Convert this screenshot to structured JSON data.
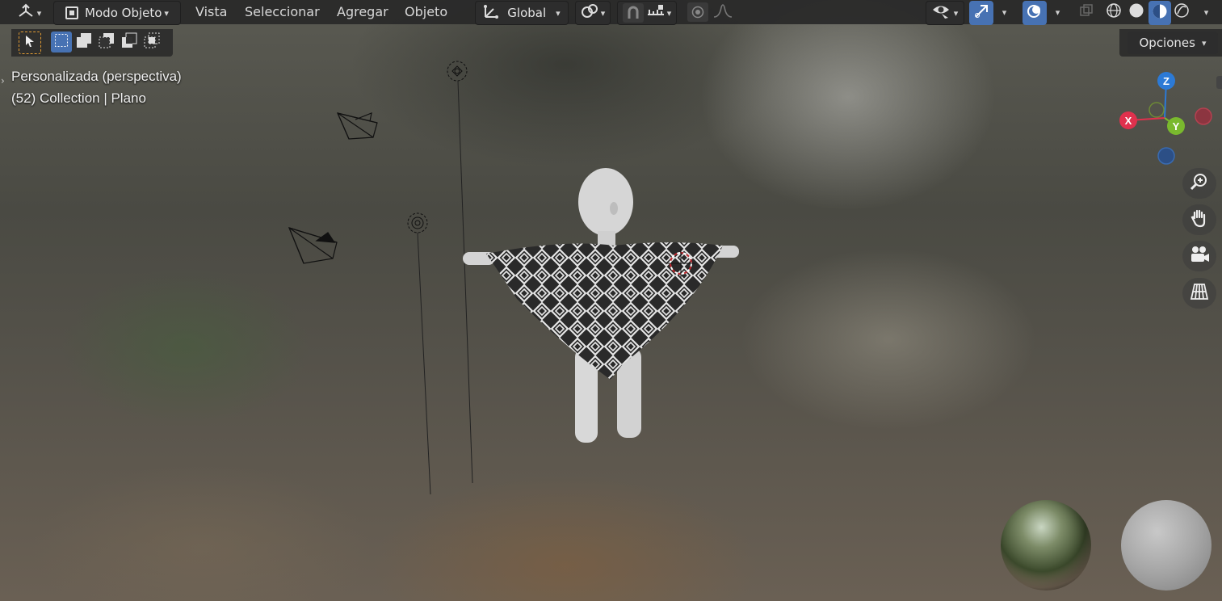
{
  "header": {
    "editor_type_icon": "viewport-gizmo-icon",
    "mode_label": "Modo Objeto",
    "menus": [
      "Vista",
      "Seleccionar",
      "Agregar",
      "Objeto"
    ],
    "transform_orientation": "Global"
  },
  "toolbar": {
    "select_modes": [
      "select-new",
      "select-extend",
      "select-subtract",
      "select-invert",
      "select-intersect"
    ]
  },
  "overlay": {
    "view_name": "Personalizada (perspectiva)",
    "collection_info": "(52) Collection | Plano"
  },
  "options_label": "Opciones",
  "gizmo": {
    "z": "Z",
    "x": "X",
    "y": "Y"
  },
  "colors": {
    "accent": "#4772b3",
    "x_axis": "#e0314d",
    "y_axis": "#7ab92e",
    "z_axis": "#2c7ad6",
    "header_bg": "#282828"
  }
}
